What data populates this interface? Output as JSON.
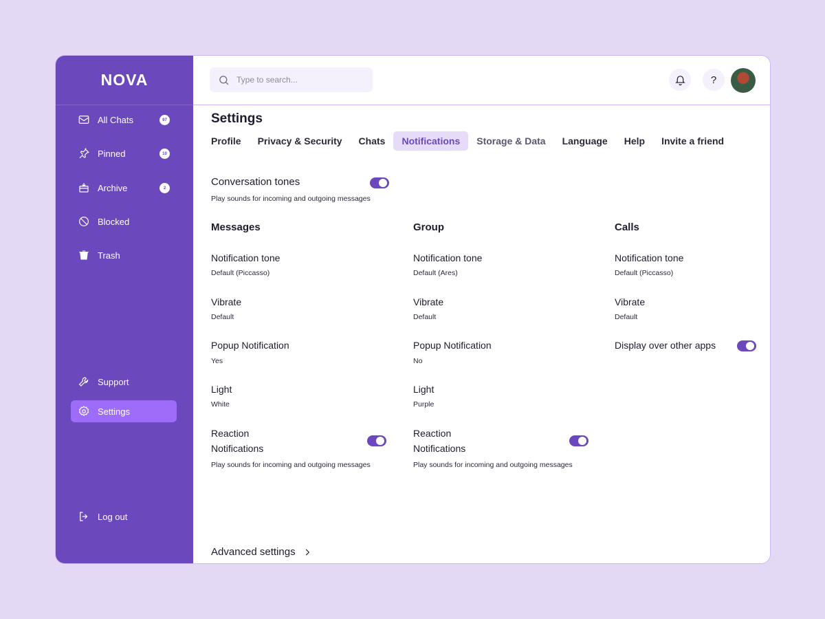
{
  "app": {
    "logo": "NOVA"
  },
  "sidebar": {
    "items": [
      {
        "label": "All Chats",
        "badge": "97",
        "icon": "mail-icon"
      },
      {
        "label": "Pinned",
        "badge": "10",
        "icon": "pin-icon"
      },
      {
        "label": "Archive",
        "badge": "2",
        "icon": "archive-icon"
      },
      {
        "label": "Blocked",
        "icon": "blocked-icon"
      },
      {
        "label": "Trash",
        "icon": "trash-icon"
      }
    ],
    "bottom": [
      {
        "label": "Support",
        "icon": "wrench-icon"
      },
      {
        "label": "Settings",
        "icon": "gear-icon",
        "active": true
      }
    ],
    "logout": {
      "label": "Log out",
      "icon": "logout-icon"
    }
  },
  "topbar": {
    "search_placeholder": "Type to search...",
    "help_label": "?"
  },
  "page": {
    "title": "Settings",
    "tabs": [
      "Profile",
      "Privacy & Security",
      "Chats",
      "Notifications",
      "Storage & Data",
      "Language",
      "Help",
      "Invite a friend"
    ],
    "active_tab": "Notifications"
  },
  "conversation": {
    "title": "Conversation tones",
    "subtitle": "Play sounds for incoming and outgoing messages",
    "enabled": true
  },
  "messages": {
    "title": "Messages",
    "tone_label": "Notification tone",
    "tone_value": "Default (Piccasso)",
    "vibrate_label": "Vibrate",
    "vibrate_value": "Default",
    "popup_label": "Popup Notification",
    "popup_value": "Yes",
    "light_label": "Light",
    "light_value": "White",
    "reaction_label_1": "Reaction",
    "reaction_label_2": "Notifications",
    "reaction_sub": "Play sounds for incoming and outgoing messages",
    "reaction_enabled": true
  },
  "group": {
    "title": "Group",
    "tone_label": "Notification tone",
    "tone_value": "Default (Ares)",
    "vibrate_label": "Vibrate",
    "vibrate_value": "Default",
    "popup_label": "Popup Notification",
    "popup_value": "No",
    "light_label": "Light",
    "light_value": "Purple",
    "reaction_label_1": "Reaction",
    "reaction_label_2": "Notifications",
    "reaction_sub": "Play sounds for incoming and outgoing messages",
    "reaction_enabled": true
  },
  "calls": {
    "title": "Calls",
    "tone_label": "Notification tone",
    "tone_value": "Default (Piccasso)",
    "vibrate_label": "Vibrate",
    "vibrate_value": "Default",
    "display_label": "Display over other apps",
    "display_enabled": true
  },
  "advanced": {
    "label": "Advanced settings"
  },
  "colors": {
    "brand": "#6B48BC",
    "active_item": "#9D6CF8",
    "background": "#E3D9F5",
    "tab_active_bg": "#E6DCFA"
  }
}
